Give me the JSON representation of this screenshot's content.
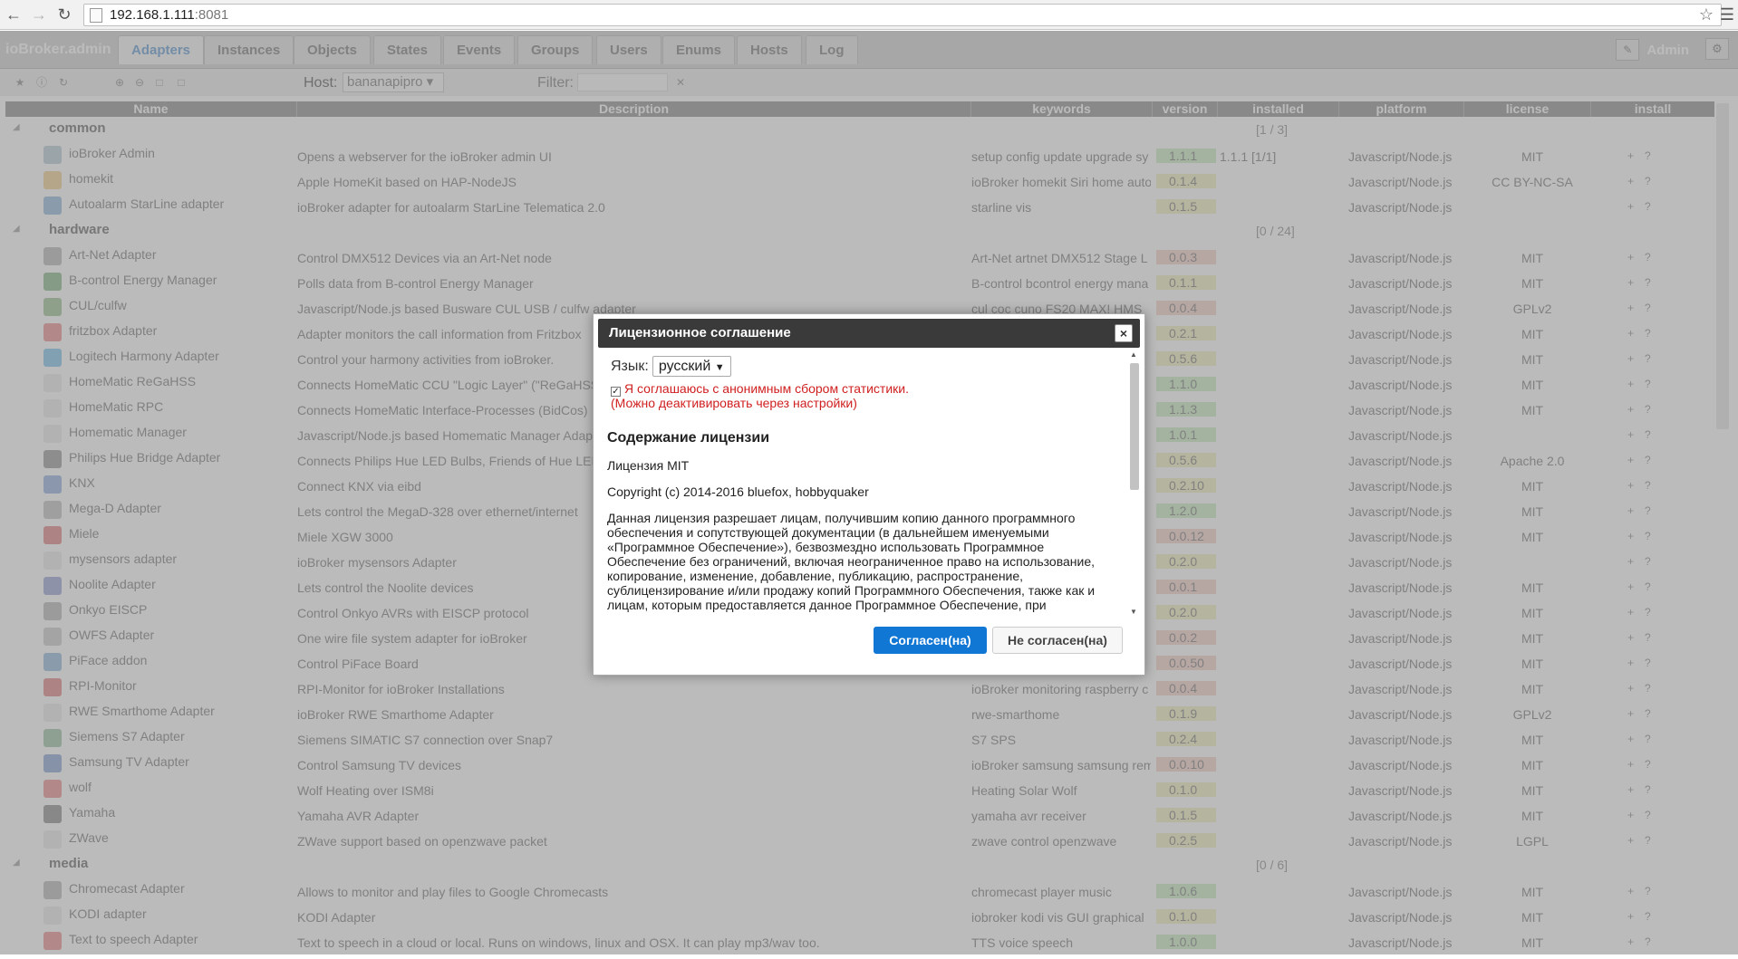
{
  "browser": {
    "url_host": "192.168.1.111",
    "url_port": ":8081"
  },
  "app": {
    "brand": "ioBroker.admin",
    "tabs": [
      "Adapters",
      "Instances",
      "Objects",
      "States",
      "Events",
      "Groups",
      "Users",
      "Enums",
      "Hosts",
      "Log"
    ],
    "user": "Admin"
  },
  "toolbar": {
    "host_label": "Host:",
    "host_value": "bananapipro",
    "filter_label": "Filter:"
  },
  "columns": [
    "Name",
    "Description",
    "keywords",
    "version",
    "installed",
    "platform",
    "license",
    "install"
  ],
  "groups": [
    {
      "name": "common",
      "count": "[1 / 3]",
      "rows": [
        {
          "name": "ioBroker Admin",
          "desc": "Opens a webserver for the ioBroker admin UI",
          "kw": "setup config update upgrade sy",
          "ver": "1.1.1",
          "vc": "green",
          "inst": "1.1.1     [1/1]",
          "plat": "Javascript/Node.js",
          "lic": "MIT",
          "icolor": "#8ab"
        },
        {
          "name": "homekit",
          "desc": "Apple HomeKit based on HAP-NodeJS",
          "kw": "ioBroker homekit Siri home auto",
          "ver": "0.1.4",
          "vc": "yellow",
          "inst": "",
          "plat": "Javascript/Node.js",
          "lic": "CC BY-NC-SA",
          "icolor": "#e9b24a"
        },
        {
          "name": "Autoalarm StarLine adapter",
          "desc": "ioBroker adapter for autoalarm StarLine Telematica 2.0",
          "kw": "starline vis",
          "ver": "0.1.5",
          "vc": "yellow",
          "inst": "",
          "plat": "Javascript/Node.js",
          "lic": "",
          "icolor": "#4a8ac9"
        }
      ]
    },
    {
      "name": "hardware",
      "count": "[0 / 24]",
      "rows": [
        {
          "name": "Art-Net Adapter",
          "desc": "Control DMX512 Devices via an Art-Net node",
          "kw": "Art-Net artnet DMX512 Stage L",
          "ver": "0.0.3",
          "vc": "red",
          "inst": "",
          "plat": "Javascript/Node.js",
          "lic": "MIT",
          "icolor": "#888"
        },
        {
          "name": "B-control Energy Manager",
          "desc": "Polls data from B-control Energy Manager",
          "kw": "B-control bcontrol energy mana",
          "ver": "0.1.1",
          "vc": "yellow",
          "inst": "",
          "plat": "Javascript/Node.js",
          "lic": "MIT",
          "icolor": "#3b8a3b"
        },
        {
          "name": "CUL/culfw",
          "desc": "Javascript/Node.js based Busware CUL USB / culfw adapter",
          "kw": "cul coc cuno FS20 MAX! HMS",
          "ver": "0.0.4",
          "vc": "red",
          "inst": "",
          "plat": "Javascript/Node.js",
          "lic": "GPLv2",
          "icolor": "#5a9a4a"
        },
        {
          "name": "fritzbox Adapter",
          "desc": "Adapter monitors the call information from Fritzbox",
          "kw": "",
          "ver": "0.2.1",
          "vc": "yellow",
          "inst": "",
          "plat": "Javascript/Node.js",
          "lic": "MIT",
          "icolor": "#d44"
        },
        {
          "name": "Logitech Harmony Adapter",
          "desc": "Control your harmony activities from ioBroker.",
          "kw": "",
          "ver": "0.5.6",
          "vc": "yellow",
          "inst": "",
          "plat": "Javascript/Node.js",
          "lic": "MIT",
          "icolor": "#2a9ad9"
        },
        {
          "name": "HomeMatic ReGaHSS",
          "desc": "Connects HomeMatic CCU \"Logic Layer\" (\"ReGaHSS\")",
          "kw": "",
          "ver": "1.1.0",
          "vc": "green",
          "inst": "",
          "plat": "Javascript/Node.js",
          "lic": "MIT",
          "icolor": "#ddd"
        },
        {
          "name": "HomeMatic RPC",
          "desc": "Connects HomeMatic Interface-Processes (BidCos)",
          "kw": "",
          "ver": "1.1.3",
          "vc": "green",
          "inst": "",
          "plat": "Javascript/Node.js",
          "lic": "MIT",
          "icolor": "#ddd"
        },
        {
          "name": "Homematic Manager",
          "desc": "Javascript/Node.js based Homematic Manager Adapter",
          "kw": "",
          "ver": "1.0.1",
          "vc": "green",
          "inst": "",
          "plat": "Javascript/Node.js",
          "lic": "",
          "icolor": "#ddd"
        },
        {
          "name": "Philips Hue Bridge Adapter",
          "desc": "Connects Philips Hue LED Bulbs, Friends of Hue LED",
          "kw": "",
          "ver": "0.5.6",
          "vc": "yellow",
          "inst": "",
          "plat": "Javascript/Node.js",
          "lic": "Apache 2.0",
          "icolor": "#555"
        },
        {
          "name": "KNX",
          "desc": "Connect KNX via eibd",
          "kw": "",
          "ver": "0.2.10",
          "vc": "yellow",
          "inst": "",
          "plat": "Javascript/Node.js",
          "lic": "MIT",
          "icolor": "#4a7ac9"
        },
        {
          "name": "Mega-D Adapter",
          "desc": "Lets control the MegaD-328 over ethernet/internet",
          "kw": "",
          "ver": "1.2.0",
          "vc": "green",
          "inst": "",
          "plat": "Javascript/Node.js",
          "lic": "MIT",
          "icolor": "#999"
        },
        {
          "name": "Miele",
          "desc": "Miele XGW 3000",
          "kw": "",
          "ver": "0.0.12",
          "vc": "red",
          "inst": "",
          "plat": "Javascript/Node.js",
          "lic": "MIT",
          "icolor": "#c33"
        },
        {
          "name": "mysensors adapter",
          "desc": "ioBroker mysensors Adapter",
          "kw": "",
          "ver": "0.2.0",
          "vc": "yellow",
          "inst": "",
          "plat": "Javascript/Node.js",
          "lic": "",
          "icolor": "#ddd"
        },
        {
          "name": "Noolite Adapter",
          "desc": "Lets control the Noolite devices",
          "kw": "",
          "ver": "0.0.1",
          "vc": "red",
          "inst": "",
          "plat": "Javascript/Node.js",
          "lic": "MIT",
          "icolor": "#5a6ab9"
        },
        {
          "name": "Onkyo EISCP",
          "desc": "Control Onkyo AVRs with EISCP protocol",
          "kw": "",
          "ver": "0.2.0",
          "vc": "yellow",
          "inst": "",
          "plat": "Javascript/Node.js",
          "lic": "MIT",
          "icolor": "#888"
        },
        {
          "name": "OWFS Adapter",
          "desc": "One wire file system adapter for ioBroker",
          "kw": "",
          "ver": "0.0.2",
          "vc": "red",
          "inst": "",
          "plat": "Javascript/Node.js",
          "lic": "MIT",
          "icolor": "#aaa"
        },
        {
          "name": "PiFace addon",
          "desc": "Control PiFace Board",
          "kw": "",
          "ver": "0.0.50",
          "vc": "red",
          "inst": "",
          "plat": "Javascript/Node.js",
          "lic": "MIT",
          "icolor": "#4a8ac9"
        },
        {
          "name": "RPI-Monitor",
          "desc": "RPI-Monitor for ioBroker Installations",
          "kw": "ioBroker monitoring raspberry c",
          "ver": "0.0.4",
          "vc": "red",
          "inst": "",
          "plat": "Javascript/Node.js",
          "lic": "MIT",
          "icolor": "#c33"
        },
        {
          "name": "RWE Smarthome Adapter",
          "desc": "ioBroker RWE Smarthome Adapter",
          "kw": "rwe-smarthome",
          "ver": "0.1.9",
          "vc": "yellow",
          "inst": "",
          "plat": "Javascript/Node.js",
          "lic": "GPLv2",
          "icolor": "#ddd"
        },
        {
          "name": "Siemens S7 Adapter",
          "desc": "Siemens SIMATIC S7 connection over Snap7",
          "kw": "S7 SPS",
          "ver": "0.2.4",
          "vc": "yellow",
          "inst": "",
          "plat": "Javascript/Node.js",
          "lic": "MIT",
          "icolor": "#5a9a6a"
        },
        {
          "name": "Samsung TV Adapter",
          "desc": "Control Samsung TV devices",
          "kw": "ioBroker samsung samsung rem",
          "ver": "0.0.10",
          "vc": "red",
          "inst": "",
          "plat": "Javascript/Node.js",
          "lic": "MIT",
          "icolor": "#3a6ab9"
        },
        {
          "name": "wolf",
          "desc": "Wolf Heating over ISM8i",
          "kw": "Heating Solar Wolf",
          "ver": "0.1.0",
          "vc": "yellow",
          "inst": "",
          "plat": "Javascript/Node.js",
          "lic": "MIT",
          "icolor": "#d44"
        },
        {
          "name": "Yamaha",
          "desc": "Yamaha AVR Adapter",
          "kw": "yamaha avr receiver",
          "ver": "0.1.5",
          "vc": "yellow",
          "inst": "",
          "plat": "Javascript/Node.js",
          "lic": "MIT",
          "icolor": "#444"
        },
        {
          "name": "ZWave",
          "desc": "ZWave support based on openzwave packet",
          "kw": "zwave control openzwave",
          "ver": "0.2.5",
          "vc": "yellow",
          "inst": "",
          "plat": "Javascript/Node.js",
          "lic": "LGPL",
          "icolor": "#ddd"
        }
      ]
    },
    {
      "name": "media",
      "count": "[0 / 6]",
      "rows": [
        {
          "name": "Chromecast Adapter",
          "desc": "Allows to monitor and play files to Google Chromecasts",
          "kw": "chromecast player music",
          "ver": "1.0.6",
          "vc": "green",
          "inst": "",
          "plat": "Javascript/Node.js",
          "lic": "MIT",
          "icolor": "#888"
        },
        {
          "name": "KODI adapter",
          "desc": "KODI Adapter",
          "kw": "iobroker kodi vis GUI graphical",
          "ver": "0.1.0",
          "vc": "yellow",
          "inst": "",
          "plat": "Javascript/Node.js",
          "lic": "MIT",
          "icolor": "#ddd"
        },
        {
          "name": "Text to speech Adapter",
          "desc": "Text to speech in a cloud or local. Runs on windows, linux and OSX. It can play mp3/wav too.",
          "kw": "TTS voice speech",
          "ver": "1.0.0",
          "vc": "green",
          "inst": "",
          "plat": "Javascript/Node.js",
          "lic": "MIT",
          "icolor": "#d44"
        }
      ]
    }
  ],
  "dialog": {
    "title": "Лицензионное соглашение",
    "close": "×",
    "language_label": "Язык:",
    "language_value": "русский",
    "stats_line1": "Я соглашаюсь с анонимным сбором статистики.",
    "stats_line2": "(Можно деактивировать через настройки)",
    "license_heading": "Содержание лицензии",
    "license_name": "Лицензия MIT",
    "copyright": "Copyright (c) 2014-2016 bluefox, hobbyquaker",
    "license_text": "Данная лицензия разрешает лицам, получившим копию данного программного обеспечения и сопутствующей документации (в дальнейшем именуемыми «Программное Обеспечение»), безвозмездно использовать Программное Обеспечение без ограничений, включая неограниченное право на использование, копирование, изменение, добавление, публикацию, распространение, сублицензирование и/или продажу копий Программного Обеспечения, также как и лицам, которым предоставляется данное Программное Обеспечение, при",
    "agree_button": "Согласен(на)",
    "decline_button": "Не согласен(на)"
  },
  "colors": {
    "agree_button": "#1177d4",
    "dialog_title_bg": "#3a3a3a",
    "stats_text": "#d02020"
  }
}
